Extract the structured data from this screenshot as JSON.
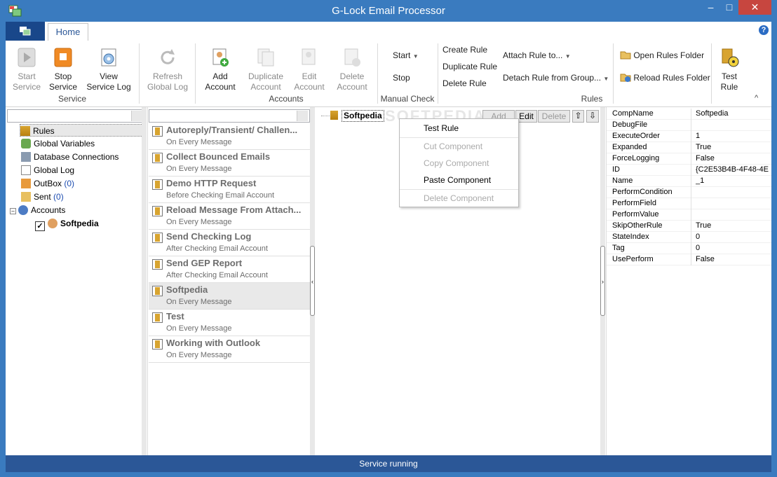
{
  "window": {
    "title": "G-Lock Email Processor",
    "minimize": "–",
    "maximize": "□",
    "close": "✕"
  },
  "ribbon": {
    "home_tab": "Home",
    "help": "?",
    "collapse": "^",
    "service": {
      "label": "Service",
      "start": [
        "Start",
        "Service"
      ],
      "stop": [
        "Stop",
        "Service"
      ],
      "view_log": [
        "View",
        "Service Log"
      ]
    },
    "refresh": [
      "Refresh",
      "Global Log"
    ],
    "accounts": {
      "label": "Accounts",
      "add": [
        "Add",
        "Account"
      ],
      "duplicate": [
        "Duplicate",
        "Account"
      ],
      "edit": [
        "Edit",
        "Account"
      ],
      "delete": [
        "Delete",
        "Account"
      ]
    },
    "manual_check": {
      "label": "Manual Check",
      "start": "Start",
      "stop": "Stop"
    },
    "rules": {
      "label": "Rules",
      "create": "Create Rule",
      "duplicate": "Duplicate Rule",
      "delete": "Delete Rule",
      "attach": "Attach Rule to...",
      "detach": "Detach Rule from Group...",
      "open_folder": "Open Rules Folder",
      "reload_folder": "Reload Rules Folder",
      "test": [
        "Test",
        "Rule"
      ]
    }
  },
  "tree": {
    "items": [
      {
        "label": "Rules",
        "count": ""
      },
      {
        "label": "Global Variables",
        "count": ""
      },
      {
        "label": "Database Connections",
        "count": ""
      },
      {
        "label": "Global Log",
        "count": ""
      },
      {
        "label": "OutBox ",
        "count": "(0)"
      },
      {
        "label": "Sent ",
        "count": "(0)"
      },
      {
        "label": "Accounts",
        "count": ""
      }
    ],
    "account": "Softpedia"
  },
  "rules_list": [
    {
      "name": "Autoreply/Transient/ Challen...",
      "trigger": "On Every Message"
    },
    {
      "name": "Collect Bounced Emails",
      "trigger": "On Every Message"
    },
    {
      "name": "Demo HTTP Request",
      "trigger": "Before Checking Email Account"
    },
    {
      "name": "Reload Message From Attach...",
      "trigger": "On Every Message"
    },
    {
      "name": "Send Checking Log",
      "trigger": "After Checking Email Account"
    },
    {
      "name": "Send GEP Report",
      "trigger": "After Checking Email Account"
    },
    {
      "name": "Softpedia",
      "trigger": "On Every Message"
    },
    {
      "name": "Test",
      "trigger": "On Every Message"
    },
    {
      "name": "Working with Outlook",
      "trigger": "On Every Message"
    }
  ],
  "editor": {
    "rule_node": "Softpedia",
    "add": "Add",
    "edit": "Edit",
    "delete": "Delete",
    "watermark": "SOFTPEDIA"
  },
  "context_menu": {
    "test": "Test Rule",
    "cut": "Cut Component",
    "copy": "Copy Component",
    "paste": "Paste Component",
    "delete": "Delete Component"
  },
  "properties": [
    {
      "k": "CompName",
      "v": "Softpedia"
    },
    {
      "k": "DebugFile",
      "v": ""
    },
    {
      "k": "ExecuteOrder",
      "v": "1"
    },
    {
      "k": "Expanded",
      "v": "True"
    },
    {
      "k": "ForceLogging",
      "v": "False"
    },
    {
      "k": "ID",
      "v": "{C2E53B4B-4F48-4E"
    },
    {
      "k": "Name",
      "v": "_1"
    },
    {
      "k": "PerformCondition",
      "v": ""
    },
    {
      "k": "PerformField",
      "v": ""
    },
    {
      "k": "PerformValue",
      "v": ""
    },
    {
      "k": "SkipOtherRule",
      "v": "True"
    },
    {
      "k": "StateIndex",
      "v": "0"
    },
    {
      "k": "Tag",
      "v": "0"
    },
    {
      "k": "UsePerform",
      "v": "False"
    }
  ],
  "status": "Service running"
}
